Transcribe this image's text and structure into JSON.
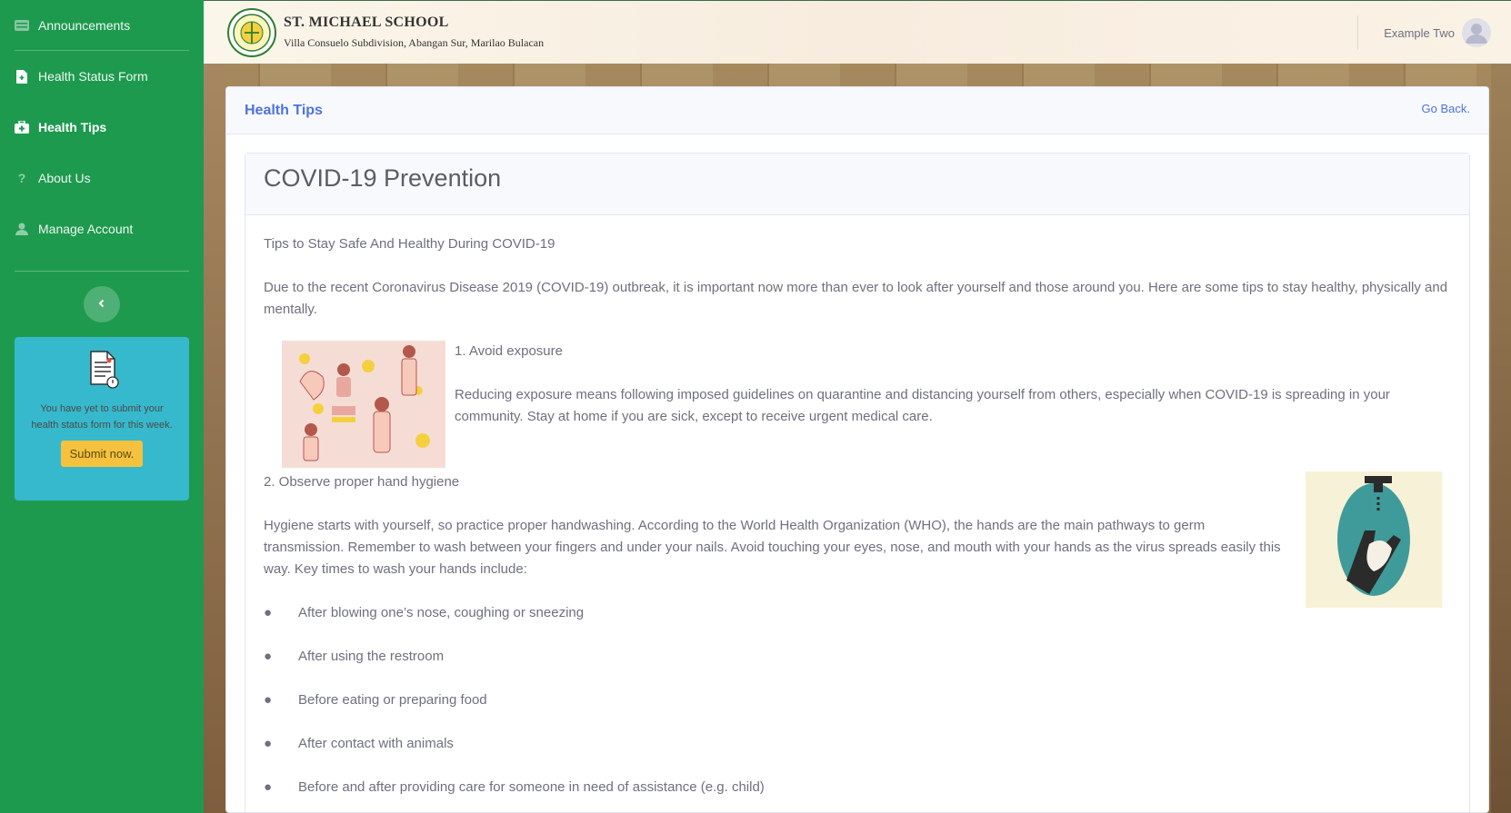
{
  "sidebar": {
    "items": [
      {
        "label": "Announcements",
        "icon": "list-icon"
      },
      {
        "label": "Health Status Form",
        "icon": "file-icon"
      },
      {
        "label": "Health Tips",
        "icon": "medkit-icon"
      },
      {
        "label": "About Us",
        "icon": "question-icon"
      },
      {
        "label": "Manage Account",
        "icon": "user-icon"
      }
    ],
    "active_item": "Health Tips",
    "reminder": {
      "message": "You have yet to submit your health status form for this week.",
      "button_label": "Submit now."
    }
  },
  "header": {
    "school_name": "ST. MICHAEL SCHOOL",
    "school_address": "Villa Consuelo Subdivision, Abangan Sur, Marilao Bulacan",
    "user_name": "Example Two"
  },
  "main": {
    "title": "Health Tips",
    "back_label": "Go Back.",
    "article": {
      "title": "COVID-19 Prevention",
      "subtitle": "Tips to Stay Safe And Healthy During COVID-19",
      "intro": "Due to the recent Coronavirus Disease 2019 (COVID-19) outbreak, it is important now more than ever to look after yourself and those around you. Here are some tips to stay healthy, physically and mentally.",
      "tip1_title": "1. Avoid exposure",
      "tip1_text": "Reducing exposure means following imposed guidelines on quarantine and distancing yourself from others, especially when COVID-19 is spreading in your community. Stay at home if you are sick, except to receive urgent medical care.",
      "tip2_title": "2. Observe proper hand hygiene",
      "tip2_text": "Hygiene starts with yourself, so practice proper handwashing. According to the World Health Organization (WHO), the hands are the main pathways to germ transmission. Remember to wash between your fingers and under your nails. Avoid touching your eyes, nose, and mouth with your hands as the virus spreads easily this way. Key times to wash your hands include:",
      "bullets": [
        "After blowing one’s nose, coughing or sneezing",
        "After using the restroom",
        "Before eating or preparing food",
        "After contact with animals",
        "Before and after providing care for someone in need of assistance (e.g. child)"
      ]
    }
  },
  "colors": {
    "sidebar": "#1e9a4f",
    "accent": "#4e73df",
    "cta_card": "#36b9cc",
    "cta_button": "#f6c23e"
  }
}
